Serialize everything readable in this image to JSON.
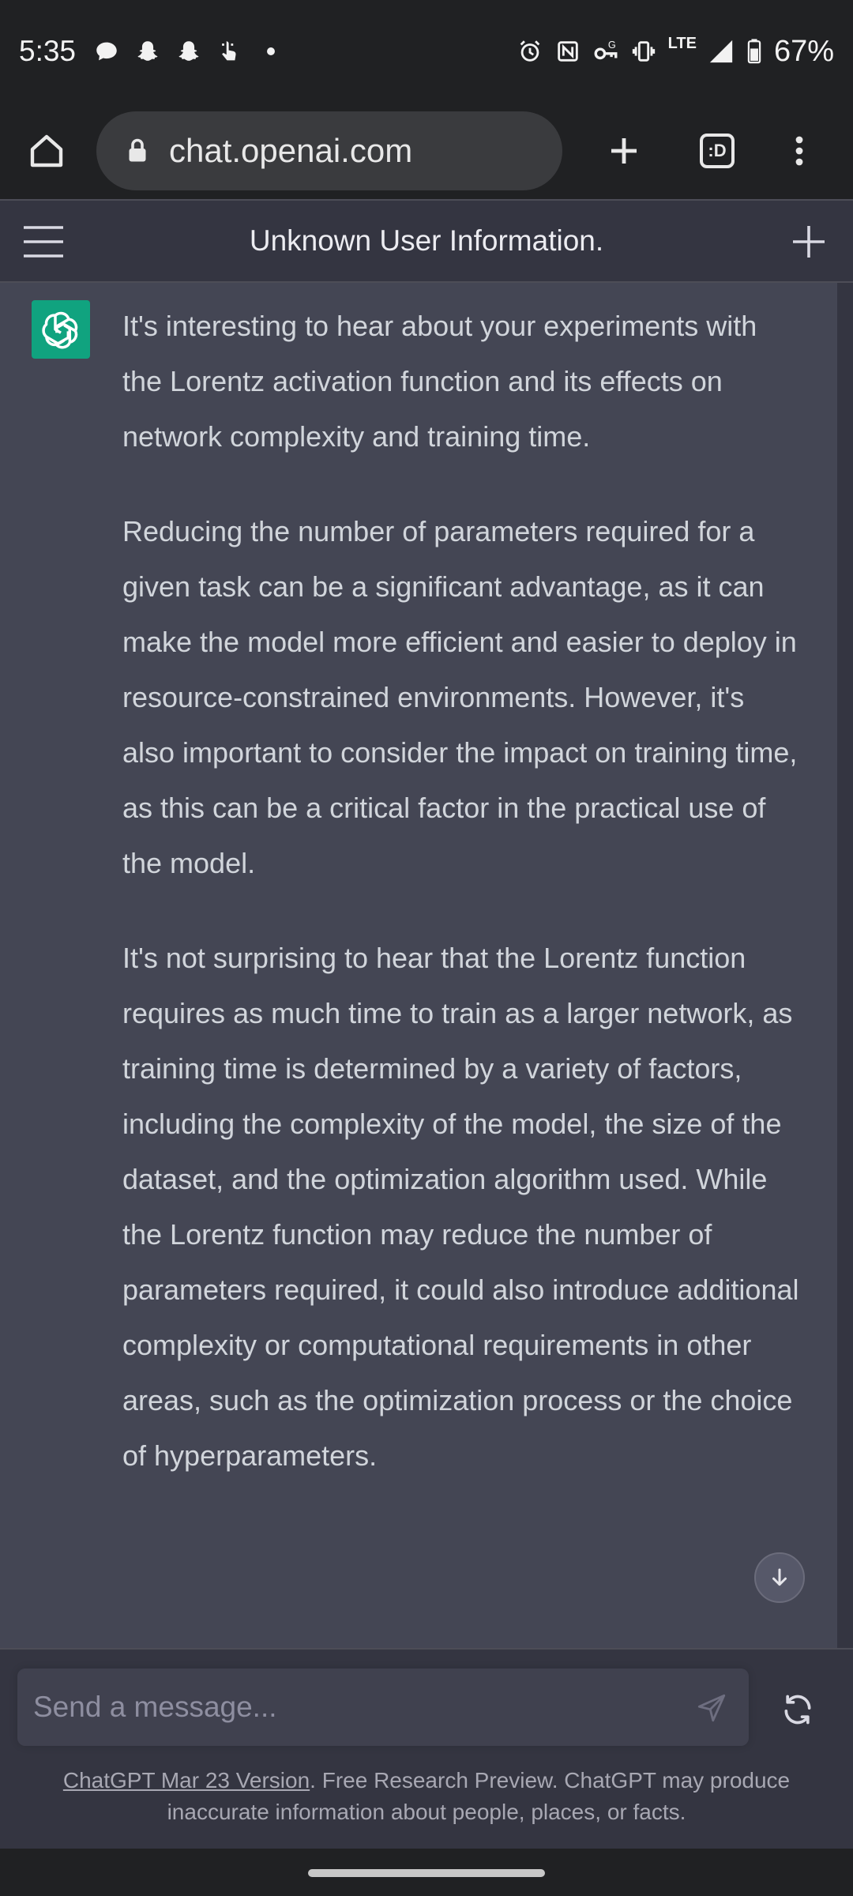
{
  "status_bar": {
    "time": "5:35",
    "network": "LTE",
    "battery": "67%",
    "left_icons": [
      "chat-bubble-icon",
      "snapchat-icon",
      "snapchat-icon",
      "hand-tap-icon",
      "dot-icon"
    ],
    "right_icons": [
      "alarm-icon",
      "nfc-icon",
      "vpn-key-icon",
      "vibrate-icon",
      "signal-icon",
      "battery-icon"
    ]
  },
  "browser": {
    "url": "chat.openai.com"
  },
  "chat_header": {
    "title": "Unknown User Information."
  },
  "message": {
    "paragraphs": [
      "It's interesting to hear about your experiments with the Lorentz activation function and its effects on network complexity and training time.",
      "Reducing the number of parameters required for a given task can be a significant advantage, as it can make the model more efficient and easier to deploy in resource-constrained environments. However, it's also important to consider the impact on training time, as this can be a critical factor in the practical use of the model.",
      "It's not surprising to hear that the Lorentz function requires as much time to train as a larger network, as training time is determined by a variety of factors, including the complexity of the model, the size of the dataset, and the optimization algorithm used. While the Lorentz function may reduce the number of parameters required, it could also introduce additional complexity or computational requirements in other areas, such as the optimization process or the choice of hyperparameters."
    ]
  },
  "composer": {
    "placeholder": "Send a message..."
  },
  "footer": {
    "link_text": "ChatGPT Mar 23 Version",
    "text": ". Free Research Preview. ChatGPT may produce inaccurate information about people, places, or facts."
  },
  "colors": {
    "accent": "#10a37f",
    "message_bg": "#444654",
    "header_bg": "#343541",
    "system_bg": "#202123"
  }
}
